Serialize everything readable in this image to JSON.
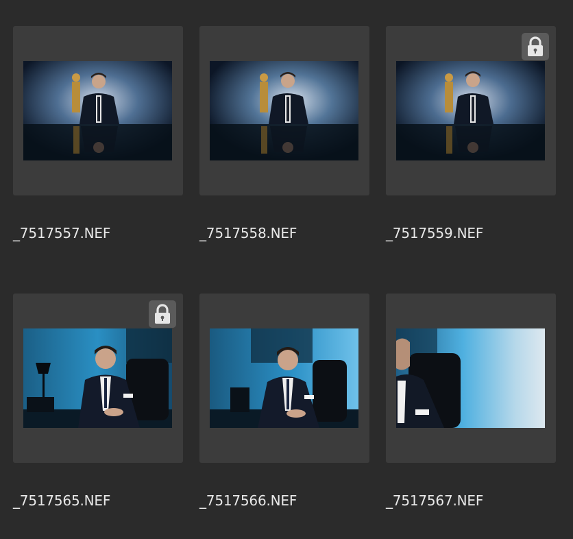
{
  "thumbnails": [
    {
      "filename": "_7517557.NEF",
      "locked": false,
      "scene": "statuette"
    },
    {
      "filename": "_7517558.NEF",
      "locked": false,
      "scene": "statuette"
    },
    {
      "filename": "_7517559.NEF",
      "locked": true,
      "scene": "statuette"
    },
    {
      "filename": "_7517565.NEF",
      "locked": true,
      "scene": "office"
    },
    {
      "filename": "_7517566.NEF",
      "locked": false,
      "scene": "office"
    },
    {
      "filename": "_7517567.NEF",
      "locked": false,
      "scene": "office-blur"
    }
  ],
  "icons": {
    "lock": "lock-icon"
  },
  "colors": {
    "background": "#2b2b2b",
    "card": "#3c3c3c",
    "lock_badge": "#5b5b5b",
    "filename_text": "#e8e8e8"
  }
}
